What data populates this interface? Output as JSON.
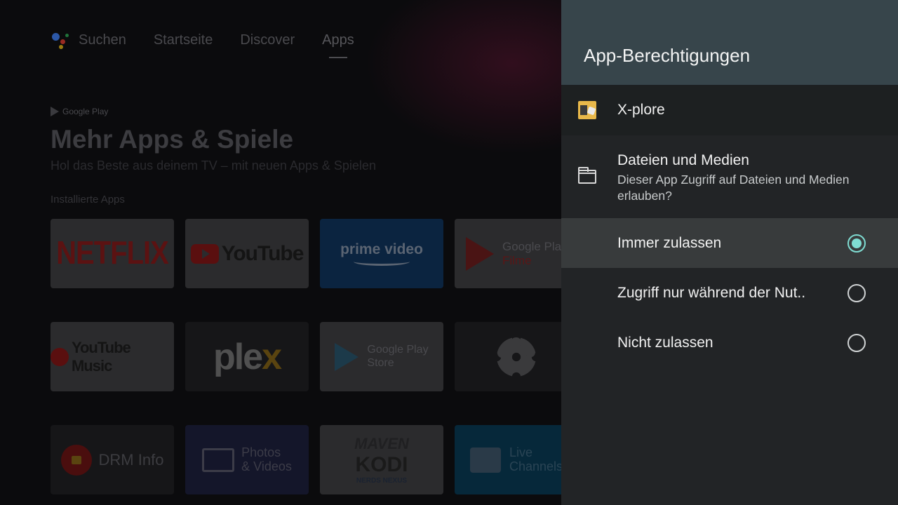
{
  "background": {
    "nav": {
      "assistant_icon": "google-assistant-icon",
      "items": [
        "Suchen",
        "Startseite",
        "Discover",
        "Apps"
      ],
      "active": "Apps"
    },
    "google_play_label": "Google Play",
    "hero_title": "Mehr Apps & Spiele",
    "hero_subtitle": "Hol das Beste aus deinem TV – mit neuen Apps & Spielen",
    "installed_label": "Installierte Apps",
    "tiles": {
      "netflix": "NETFLIX",
      "youtube": "YouTube",
      "prime_line1": "prime video",
      "gp_movies_line1": "Google Play",
      "gp_movies_line2": "Filme",
      "youtube_music": "YouTube Music",
      "plex_a": "ple",
      "plex_b": "x",
      "gp_store_line1": "Google Play",
      "gp_store_line2": "Store",
      "drm": "DRM Info",
      "photos_line1": "Photos",
      "photos_line2": "& Videos",
      "kodi_maven": "MAVEN",
      "kodi_main": "KODI",
      "kodi_sub": "NERDS NEXUS",
      "live_line1": "Live",
      "live_line2": "Channels"
    }
  },
  "panel": {
    "title": "App-Berechtigungen",
    "app": {
      "name": "X-plore",
      "icon": "x-plore-app-icon"
    },
    "permission": {
      "icon": "folder-icon",
      "title": "Dateien und Medien",
      "description": "Dieser App Zugriff auf Dateien und Medien erlauben?"
    },
    "options": [
      {
        "label": "Immer zulassen",
        "selected": true
      },
      {
        "label": "Zugriff nur während der Nut..",
        "selected": false
      },
      {
        "label": "Nicht zulassen",
        "selected": false
      }
    ],
    "accent_color": "#7fdcd2",
    "header_color": "#37454b"
  }
}
